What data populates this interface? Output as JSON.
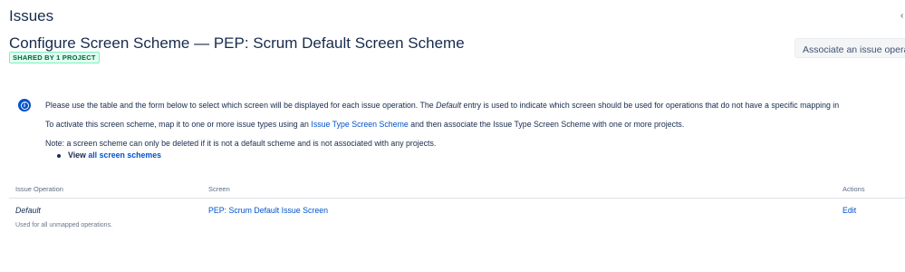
{
  "header": {
    "page_title": "Issues",
    "scheme_title": "Configure Screen Scheme — PEP: Scrum Default Screen Scheme",
    "shared_badge": "SHARED BY 1 PROJECT",
    "associate_button": "Associate an issue operation"
  },
  "info": {
    "p1_before": "Please use the table and the form below to select which screen will be displayed for each issue operation. The ",
    "p1_default": "Default",
    "p1_after": " entry is used to indicate which screen should be used for operations that do not have a specific mapping in",
    "p2_before": "To activate this screen scheme, map it to one or more issue types using an ",
    "p2_link": "Issue Type Screen Scheme",
    "p2_after": " and then associate the Issue Type Screen Scheme with one or more projects.",
    "p3": "Note: a screen scheme can only be deleted if it is not a default scheme and is not associated with any projects.",
    "view_label": "View ",
    "view_link": "all screen schemes"
  },
  "table": {
    "columns": [
      "Issue Operation",
      "Screen",
      "Actions"
    ],
    "rows": [
      {
        "operation": "Default",
        "description": "Used for all unmapped operations.",
        "screen": "PEP: Scrum Default Issue Screen",
        "action": "Edit"
      }
    ]
  },
  "icons": {
    "info": "info-circle-icon",
    "edge": "chevron-icon"
  },
  "colors": {
    "link": "#0052cc",
    "text": "#172b4d",
    "badge": "#006644"
  }
}
